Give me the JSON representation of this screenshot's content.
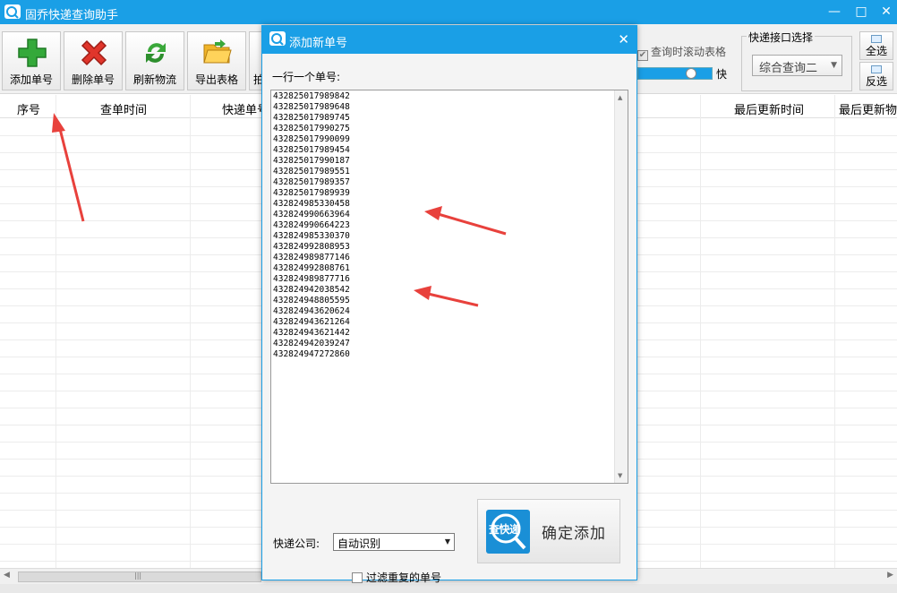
{
  "window": {
    "title": "固乔快递查询助手"
  },
  "toolbar": {
    "buttons": [
      {
        "label": "添加单号",
        "icon": "plus-icon"
      },
      {
        "label": "删除单号",
        "icon": "delete-x-icon"
      },
      {
        "label": "刷新物流",
        "icon": "refresh-icon"
      },
      {
        "label": "导出表格",
        "icon": "folder-export-icon"
      },
      {
        "label": "拍",
        "icon": "toolbar-icon"
      }
    ],
    "scroll_table_label": "查询时滚动表格",
    "speed_label": "快",
    "api_group_label": "快递接口选择",
    "api_selected": "综合查询二",
    "select_all_label": "全选",
    "invert_select_label": "反选"
  },
  "table": {
    "columns": [
      "序号",
      "查单时间",
      "快递单号",
      "最后更新时间",
      "最后更新物流"
    ]
  },
  "dialog": {
    "title": "添加新单号",
    "prompt": "一行一个单号:",
    "tracking_numbers": [
      "432825017989842",
      "432825017989648",
      "432825017989745",
      "432825017990275",
      "432825017990099",
      "432825017989454",
      "432825017990187",
      "432825017989551",
      "432825017989357",
      "432825017989939",
      "432824985330458",
      "432824990663964",
      "432824990664223",
      "432824985330370",
      "432824992808953",
      "432824989877146",
      "432824992808761",
      "432824989877716",
      "432824942038542",
      "432824948805595",
      "432824943620624",
      "432824943621264",
      "432824943621442",
      "432824942039247",
      "432824947272860"
    ],
    "company_label": "快递公司:",
    "company_selected": "自动识别",
    "dedupe_label": "过滤重复的单号",
    "confirm_label": "确定添加",
    "confirm_logo_text": "查快递"
  },
  "colors": {
    "accent": "#1a9fe6",
    "annotation_arrow": "#e8413c"
  }
}
